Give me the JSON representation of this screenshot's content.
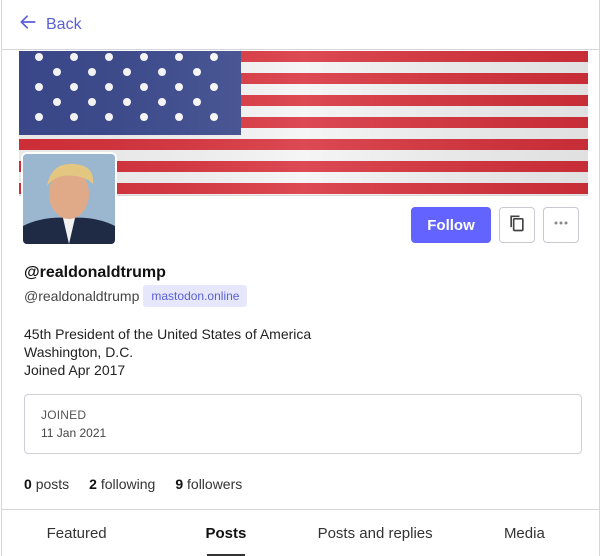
{
  "nav": {
    "back_label": "Back"
  },
  "profile": {
    "display_name": "@realdonaldtrump",
    "handle": "@realdonaldtrump",
    "server": "mastodon.online",
    "bio": [
      "45th President of the United States of America",
      "Washington, D.C.",
      "Joined Apr 2017"
    ]
  },
  "actions": {
    "follow_label": "Follow"
  },
  "joined": {
    "label": "JOINED",
    "value": "11 Jan 2021"
  },
  "counts": {
    "posts_value": "0",
    "posts_label": "posts",
    "following_value": "2",
    "following_label": "following",
    "followers_value": "9",
    "followers_label": "followers"
  },
  "tabs": [
    {
      "label": "Featured"
    },
    {
      "label": "Posts"
    },
    {
      "label": "Posts and replies"
    },
    {
      "label": "Media"
    }
  ],
  "colors": {
    "accent": "#6364ff",
    "link": "#5a5fd6"
  }
}
